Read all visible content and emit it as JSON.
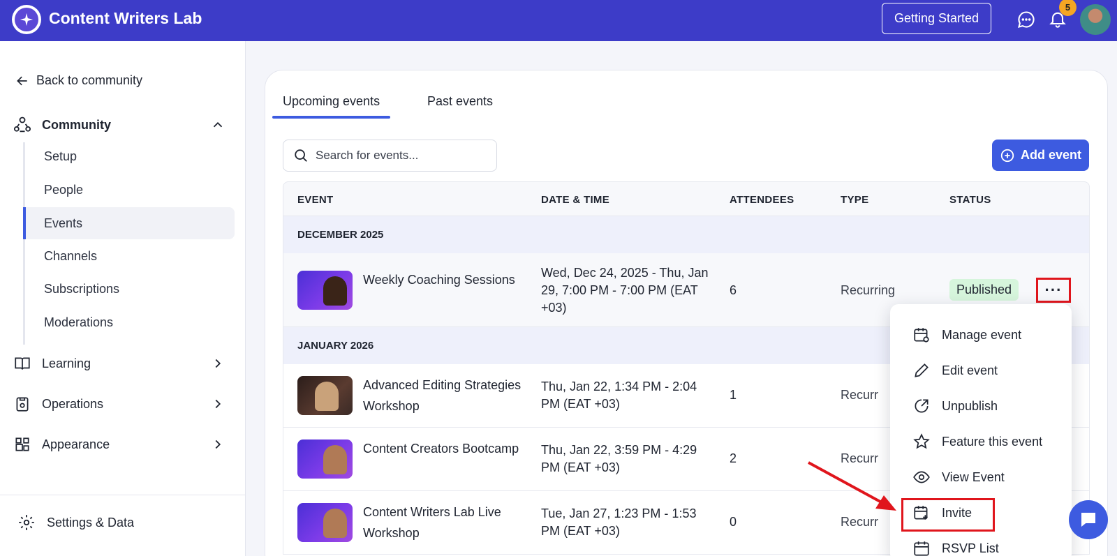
{
  "app": {
    "title": "Content Writers Lab",
    "getting_started_label": "Getting Started",
    "notification_count": "5",
    "accent_color": "#3d3cc8",
    "primary_color": "#3d5be0"
  },
  "sidebar": {
    "back_label": "Back to community",
    "community_label": "Community",
    "community_items": [
      {
        "label": "Setup"
      },
      {
        "label": "People"
      },
      {
        "label": "Events"
      },
      {
        "label": "Channels"
      },
      {
        "label": "Subscriptions"
      },
      {
        "label": "Moderations"
      }
    ],
    "active_item": "Events",
    "groups": [
      {
        "label": "Learning",
        "icon": "book-icon"
      },
      {
        "label": "Operations",
        "icon": "clipboard-icon"
      },
      {
        "label": "Appearance",
        "icon": "layout-icon"
      }
    ],
    "settings_label": "Settings & Data"
  },
  "main": {
    "tabs": [
      {
        "label": "Upcoming events",
        "active": true
      },
      {
        "label": "Past events",
        "active": false
      }
    ],
    "search": {
      "placeholder": "Search for events..."
    },
    "add_event_label": "Add event",
    "table": {
      "headers": [
        "EVENT",
        "DATE & TIME",
        "ATTENDEES",
        "TYPE",
        "STATUS"
      ],
      "groups": [
        {
          "label": "DECEMBER 2025",
          "rows": [
            {
              "name": "Weekly Coaching Sessions",
              "date": "Wed, Dec 24, 2025 - Thu, Jan 29, 7:00 PM - 7:00 PM (EAT +03)",
              "attendees": "6",
              "type": "Recurring",
              "status": "Published"
            }
          ]
        },
        {
          "label": "JANUARY 2026",
          "rows": [
            {
              "name": "Advanced Editing Strategies Workshop",
              "date": "Thu, Jan 22, 1:34 PM - 2:04 PM (EAT +03)",
              "attendees": "1",
              "type": "Recurr"
            },
            {
              "name": "Content Creators Bootcamp",
              "date": "Thu, Jan 22, 3:59 PM - 4:29 PM (EAT +03)",
              "attendees": "2",
              "type": "Recurr"
            },
            {
              "name": "Content Writers Lab Live Workshop",
              "date": "Tue, Jan 27, 1:23 PM - 1:53 PM (EAT +03)",
              "attendees": "0",
              "type": "Recurr"
            }
          ]
        }
      ]
    }
  },
  "menu": {
    "items": [
      {
        "label": "Manage event",
        "icon": "calendar-gear-icon"
      },
      {
        "label": "Edit event",
        "icon": "pencil-icon"
      },
      {
        "label": "Unpublish",
        "icon": "unpublish-icon"
      },
      {
        "label": "Feature this event",
        "icon": "star-icon"
      },
      {
        "label": "View Event",
        "icon": "eye-icon"
      },
      {
        "label": "Invite",
        "icon": "calendar-plus-icon"
      },
      {
        "label": "RSVP List",
        "icon": "calendar-icon"
      }
    ]
  },
  "annotation": {
    "highlight_color": "#e0151c"
  }
}
